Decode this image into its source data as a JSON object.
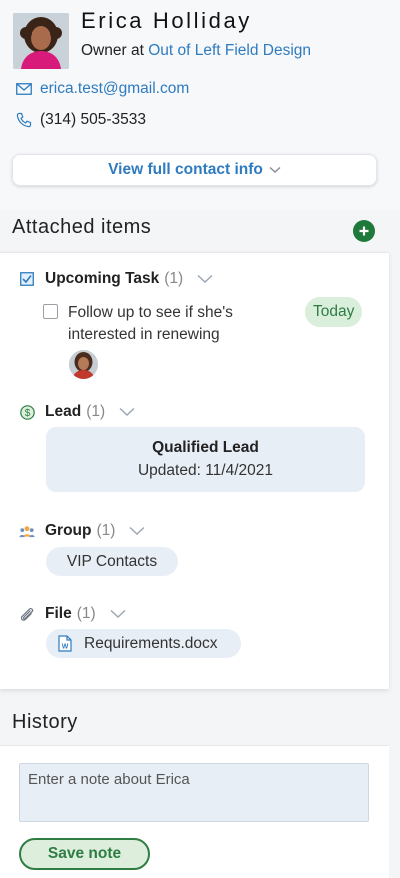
{
  "contact": {
    "name": "Erica Holliday",
    "role_prefix": "Owner at ",
    "company": "Out of Left Field Design",
    "email": "erica.test@gmail.com",
    "phone": "(314) 505-3533",
    "view_full_label": "View full contact info"
  },
  "attached": {
    "title": "Attached items",
    "task_group": {
      "label": "Upcoming Task",
      "count": "(1)",
      "task_text": "Follow up to see if she's interested in renewing",
      "due_badge": "Today"
    },
    "lead_group": {
      "label": "Lead",
      "count": "(1)",
      "lead_title": "Qualified Lead",
      "lead_updated": "Updated: 11/4/2021"
    },
    "group_group": {
      "label": "Group",
      "count": "(1)",
      "group_name": "VIP Contacts"
    },
    "file_group": {
      "label": "File",
      "count": "(1)",
      "file_name": "Requirements.docx"
    }
  },
  "history": {
    "title": "History",
    "note_placeholder": "Enter a note about Erica",
    "save_label": "Save note"
  },
  "colors": {
    "link_blue": "#2e7bbf",
    "brand_green": "#1e7a3a",
    "badge_green_bg": "#d9efdc",
    "card_bg": "#e8eef6"
  }
}
